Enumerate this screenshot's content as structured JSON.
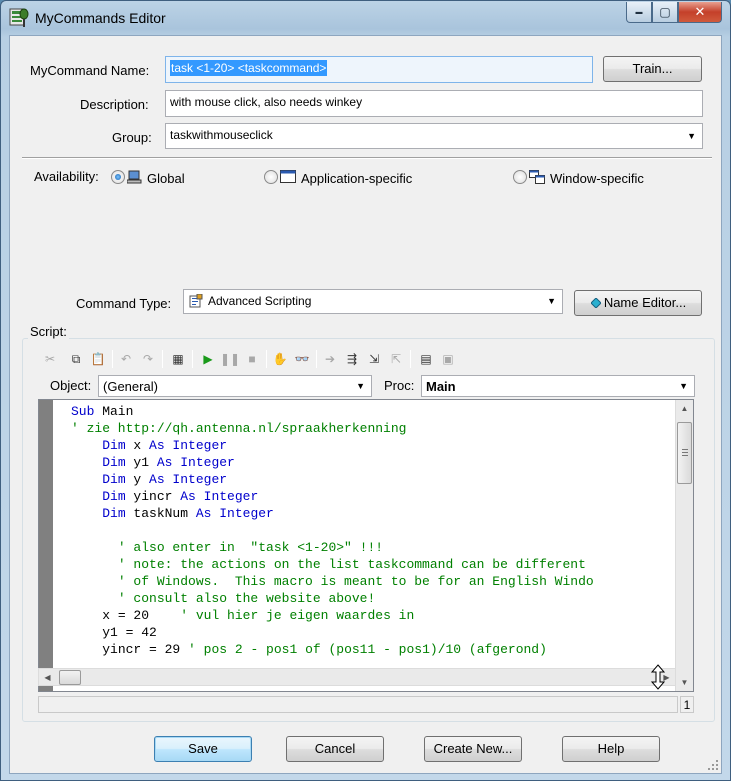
{
  "window": {
    "title": "MyCommands Editor",
    "caption": {
      "minimize": "▬",
      "maximize": "▢",
      "close": "✕"
    }
  },
  "form": {
    "name_label": "MyCommand Name:",
    "name_value": "task <1-20> <taskcommand>",
    "train_button": "Train...",
    "description_label": "Description:",
    "description_value": "with mouse click, also needs winkey",
    "group_label": "Group:",
    "group_value": "taskwithmouseclick",
    "availability_label": "Availability:",
    "availability_options": [
      {
        "label": "Global",
        "selected": true,
        "icon": "computer-icon"
      },
      {
        "label": "Application-specific",
        "selected": false,
        "icon": "window-icon"
      },
      {
        "label": "Window-specific",
        "selected": false,
        "icon": "multi-window-icon"
      }
    ],
    "command_type_label": "Command Type:",
    "command_type_value": "Advanced Scripting",
    "name_editor_button": "Name Editor..."
  },
  "script": {
    "group_label": "Script:",
    "object_label": "Object:",
    "object_value": "(General)",
    "proc_label": "Proc:",
    "proc_value": "Main",
    "toolbar_icons": [
      "cut-icon",
      "copy-icon",
      "paste-icon",
      "undo-icon",
      "redo-icon",
      "references-icon",
      "run-icon",
      "pause-icon",
      "stop-icon",
      "breakpoint-hand-icon",
      "watch-glasses-icon",
      "step-icon",
      "step-into-icon",
      "step-over-icon",
      "step-out-icon",
      "dialog-editor-icon",
      "object-browser-icon"
    ],
    "status_line": "1",
    "code_lines": [
      {
        "indent": "",
        "parts": [
          {
            "t": "kw",
            "s": "Sub"
          },
          {
            "t": "",
            "s": " Main"
          }
        ]
      },
      {
        "indent": "",
        "parts": [
          {
            "t": "cm",
            "s": "' zie http://qh.antenna.nl/spraakherkenning"
          }
        ]
      },
      {
        "indent": "    ",
        "parts": [
          {
            "t": "kw",
            "s": "Dim"
          },
          {
            "t": "",
            "s": " x "
          },
          {
            "t": "kw",
            "s": "As Integer"
          }
        ]
      },
      {
        "indent": "    ",
        "parts": [
          {
            "t": "kw",
            "s": "Dim"
          },
          {
            "t": "",
            "s": " y1 "
          },
          {
            "t": "kw",
            "s": "As Integer"
          }
        ]
      },
      {
        "indent": "    ",
        "parts": [
          {
            "t": "kw",
            "s": "Dim"
          },
          {
            "t": "",
            "s": " y "
          },
          {
            "t": "kw",
            "s": "As Integer"
          }
        ]
      },
      {
        "indent": "    ",
        "parts": [
          {
            "t": "kw",
            "s": "Dim"
          },
          {
            "t": "",
            "s": " yincr "
          },
          {
            "t": "kw",
            "s": "As Integer"
          }
        ]
      },
      {
        "indent": "    ",
        "parts": [
          {
            "t": "kw",
            "s": "Dim"
          },
          {
            "t": "",
            "s": " taskNum "
          },
          {
            "t": "kw",
            "s": "As Integer"
          }
        ]
      },
      {
        "indent": "",
        "parts": [
          {
            "t": "",
            "s": ""
          }
        ]
      },
      {
        "indent": "      ",
        "parts": [
          {
            "t": "cm",
            "s": "' also enter in  \"task <1-20>\" !!!"
          }
        ]
      },
      {
        "indent": "      ",
        "parts": [
          {
            "t": "cm",
            "s": "' note: the actions on the list taskcommand can be different"
          }
        ]
      },
      {
        "indent": "      ",
        "parts": [
          {
            "t": "cm",
            "s": "' of Windows.  This macro is meant to be for an English Windo"
          }
        ]
      },
      {
        "indent": "      ",
        "parts": [
          {
            "t": "cm",
            "s": "' consult also the website above!"
          }
        ]
      },
      {
        "indent": "    ",
        "parts": [
          {
            "t": "",
            "s": "x = 20    "
          },
          {
            "t": "cm",
            "s": "' vul hier je eigen waardes in"
          }
        ]
      },
      {
        "indent": "    ",
        "parts": [
          {
            "t": "",
            "s": "y1 = 42"
          }
        ]
      },
      {
        "indent": "    ",
        "parts": [
          {
            "t": "",
            "s": "yincr = 29 "
          },
          {
            "t": "cm",
            "s": "' pos 2 - pos1 of (pos11 - pos1)/10 (afgerond)"
          }
        ]
      }
    ]
  },
  "footer": {
    "save": "Save",
    "cancel": "Cancel",
    "create_new": "Create New...",
    "help": "Help"
  }
}
